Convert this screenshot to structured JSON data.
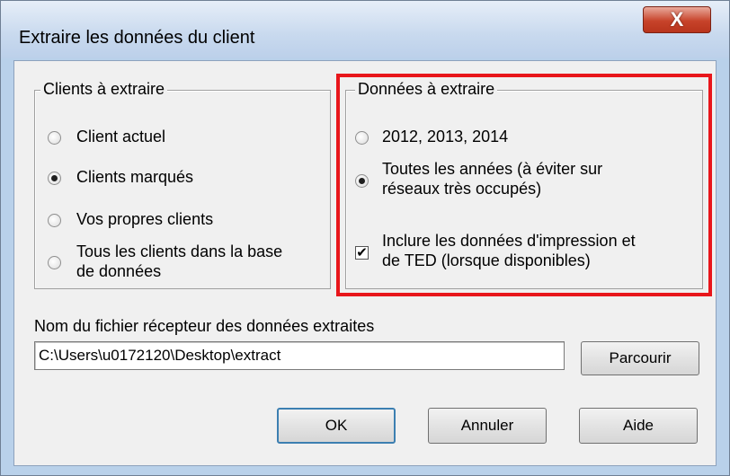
{
  "window": {
    "title": "Extraire les données du client",
    "close_glyph": "X"
  },
  "clients_group": {
    "legend": "Clients à extraire",
    "options": [
      {
        "label": "Client actuel",
        "selected": false
      },
      {
        "label": "Clients marqués",
        "selected": true
      },
      {
        "label": "Vos propres clients",
        "selected": false
      },
      {
        "label_line1": "Tous les clients dans la base",
        "label_line2": "de données",
        "selected": false
      }
    ]
  },
  "data_group": {
    "legend": "Données à extraire",
    "options": [
      {
        "label": "2012, 2013, 2014",
        "selected": false
      },
      {
        "label_line1": "Toutes les années (à éviter sur",
        "label_line2": "réseaux très occupés)",
        "selected": true
      }
    ],
    "checkbox": {
      "label_line1": "Inclure les données d'impression et",
      "label_line2": "de TED (lorsque disponibles)",
      "checked": true,
      "glyph": "✔"
    },
    "highlight_color": "#e8161b"
  },
  "file": {
    "label": "Nom du fichier récepteur des données extraites",
    "value": "C:\\Users\\u0172120\\Desktop\\extract",
    "browse_label": "Parcourir"
  },
  "buttons": {
    "ok": "OK",
    "cancel": "Annuler",
    "help": "Aide"
  }
}
